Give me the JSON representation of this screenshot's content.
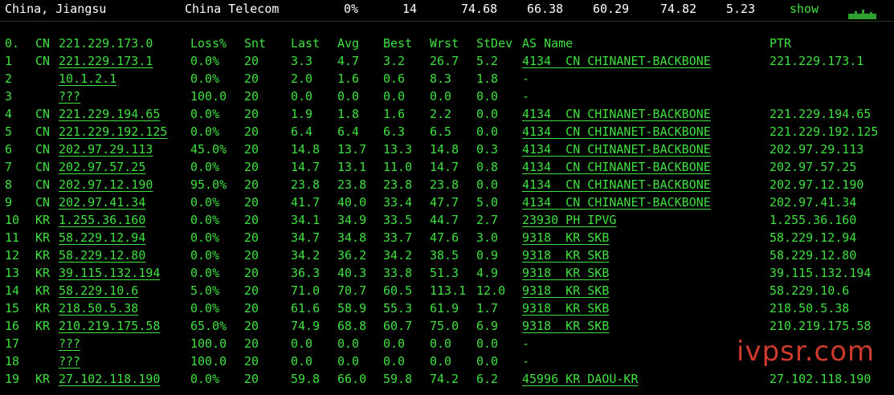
{
  "summary": {
    "location": "China, Jiangsu",
    "isp": "China Telecom",
    "loss": "0%",
    "sent": "14",
    "last": "74.68",
    "avg": "66.38",
    "best": "60.29",
    "worst": "74.82",
    "stdev": "5.23",
    "show_label": "show"
  },
  "columns": {
    "hop0": "0.",
    "cc0": "CN",
    "host0": "221.229.173.0",
    "loss": "Loss%",
    "snt": "Snt",
    "last": "Last",
    "avg": "Avg",
    "best": "Best",
    "wrst": "Wrst",
    "stdev": "StDev",
    "as_name": "AS Name",
    "ptr": "PTR"
  },
  "rows": [
    {
      "hop": "1",
      "cc": "CN",
      "host": "221.229.173.1",
      "loss": "0.0%",
      "snt": "20",
      "last": "3.3",
      "avg": "4.7",
      "best": "3.2",
      "wrst": "26.7",
      "stdev": "5.2",
      "as": "4134  CN CHINANET-BACKBONE",
      "ptr": "221.229.173.1"
    },
    {
      "hop": "2",
      "cc": "",
      "host": "10.1.2.1",
      "loss": "0.0%",
      "snt": "20",
      "last": "2.0",
      "avg": "1.6",
      "best": "0.6",
      "wrst": "8.3",
      "stdev": "1.8",
      "as": "-",
      "ptr": ""
    },
    {
      "hop": "3",
      "cc": "",
      "host": "???",
      "loss": "100.0",
      "snt": "20",
      "last": "0.0",
      "avg": "0.0",
      "best": "0.0",
      "wrst": "0.0",
      "stdev": "0.0",
      "as": "-",
      "ptr": ""
    },
    {
      "hop": "4",
      "cc": "CN",
      "host": "221.229.194.65",
      "loss": "0.0%",
      "snt": "20",
      "last": "1.9",
      "avg": "1.8",
      "best": "1.6",
      "wrst": "2.2",
      "stdev": "0.0",
      "as": "4134  CN CHINANET-BACKBONE",
      "ptr": "221.229.194.65"
    },
    {
      "hop": "5",
      "cc": "CN",
      "host": "221.229.192.125",
      "loss": "0.0%",
      "snt": "20",
      "last": "6.4",
      "avg": "6.4",
      "best": "6.3",
      "wrst": "6.5",
      "stdev": "0.0",
      "as": "4134  CN CHINANET-BACKBONE",
      "ptr": "221.229.192.125"
    },
    {
      "hop": "6",
      "cc": "CN",
      "host": "202.97.29.113",
      "loss": "45.0%",
      "snt": "20",
      "last": "14.8",
      "avg": "13.7",
      "best": "13.3",
      "wrst": "14.8",
      "stdev": "0.3",
      "as": "4134  CN CHINANET-BACKBONE",
      "ptr": "202.97.29.113"
    },
    {
      "hop": "7",
      "cc": "CN",
      "host": "202.97.57.25",
      "loss": "0.0%",
      "snt": "20",
      "last": "14.7",
      "avg": "13.1",
      "best": "11.0",
      "wrst": "14.7",
      "stdev": "0.8",
      "as": "4134  CN CHINANET-BACKBONE",
      "ptr": "202.97.57.25"
    },
    {
      "hop": "8",
      "cc": "CN",
      "host": "202.97.12.190",
      "loss": "95.0%",
      "snt": "20",
      "last": "23.8",
      "avg": "23.8",
      "best": "23.8",
      "wrst": "23.8",
      "stdev": "0.0",
      "as": "4134  CN CHINANET-BACKBONE",
      "ptr": "202.97.12.190"
    },
    {
      "hop": "9",
      "cc": "CN",
      "host": "202.97.41.34",
      "loss": "0.0%",
      "snt": "20",
      "last": "41.7",
      "avg": "40.0",
      "best": "33.4",
      "wrst": "47.7",
      "stdev": "5.0",
      "as": "4134  CN CHINANET-BACKBONE",
      "ptr": "202.97.41.34"
    },
    {
      "hop": "10",
      "cc": "KR",
      "host": "1.255.36.160",
      "loss": "0.0%",
      "snt": "20",
      "last": "34.1",
      "avg": "34.9",
      "best": "33.5",
      "wrst": "44.7",
      "stdev": "2.7",
      "as": "23930 PH IPVG",
      "ptr": "1.255.36.160"
    },
    {
      "hop": "11",
      "cc": "KR",
      "host": "58.229.12.94",
      "loss": "0.0%",
      "snt": "20",
      "last": "34.7",
      "avg": "34.8",
      "best": "33.7",
      "wrst": "47.6",
      "stdev": "3.0",
      "as": "9318  KR SKB",
      "ptr": "58.229.12.94"
    },
    {
      "hop": "12",
      "cc": "KR",
      "host": "58.229.12.80",
      "loss": "0.0%",
      "snt": "20",
      "last": "34.2",
      "avg": "36.2",
      "best": "34.2",
      "wrst": "38.5",
      "stdev": "0.9",
      "as": "9318  KR SKB",
      "ptr": "58.229.12.80"
    },
    {
      "hop": "13",
      "cc": "KR",
      "host": "39.115.132.194",
      "loss": "0.0%",
      "snt": "20",
      "last": "36.3",
      "avg": "40.3",
      "best": "33.8",
      "wrst": "51.3",
      "stdev": "4.9",
      "as": "9318  KR SKB",
      "ptr": "39.115.132.194"
    },
    {
      "hop": "14",
      "cc": "KR",
      "host": "58.229.10.6",
      "loss": "5.0%",
      "snt": "20",
      "last": "71.0",
      "avg": "70.7",
      "best": "60.5",
      "wrst": "113.1",
      "stdev": "12.0",
      "as": "9318  KR SKB",
      "ptr": "58.229.10.6"
    },
    {
      "hop": "15",
      "cc": "KR",
      "host": "218.50.5.38",
      "loss": "0.0%",
      "snt": "20",
      "last": "61.6",
      "avg": "58.9",
      "best": "55.3",
      "wrst": "61.9",
      "stdev": "1.7",
      "as": "9318  KR SKB",
      "ptr": "218.50.5.38"
    },
    {
      "hop": "16",
      "cc": "KR",
      "host": "210.219.175.58",
      "loss": "65.0%",
      "snt": "20",
      "last": "74.9",
      "avg": "68.8",
      "best": "60.7",
      "wrst": "75.0",
      "stdev": "6.9",
      "as": "9318  KR SKB",
      "ptr": "210.219.175.58"
    },
    {
      "hop": "17",
      "cc": "",
      "host": "???",
      "loss": "100.0",
      "snt": "20",
      "last": "0.0",
      "avg": "0.0",
      "best": "0.0",
      "wrst": "0.0",
      "stdev": "0.0",
      "as": "-",
      "ptr": ""
    },
    {
      "hop": "18",
      "cc": "",
      "host": "???",
      "loss": "100.0",
      "snt": "20",
      "last": "0.0",
      "avg": "0.0",
      "best": "0.0",
      "wrst": "0.0",
      "stdev": "0.0",
      "as": "-",
      "ptr": ""
    },
    {
      "hop": "19",
      "cc": "KR",
      "host": "27.102.118.190",
      "loss": "0.0%",
      "snt": "20",
      "last": "59.8",
      "avg": "66.0",
      "best": "59.8",
      "wrst": "74.2",
      "stdev": "6.2",
      "as": "45996 KR DAOU-KR",
      "ptr": "27.102.118.190"
    }
  ],
  "watermark": "ivpsr.com",
  "colors": {
    "background": "#000000",
    "text_green": "#3fe040",
    "text_white": "#ffffff",
    "watermark_red": "#e04030"
  },
  "icons": {
    "sparkline": "sparkline-icon"
  }
}
